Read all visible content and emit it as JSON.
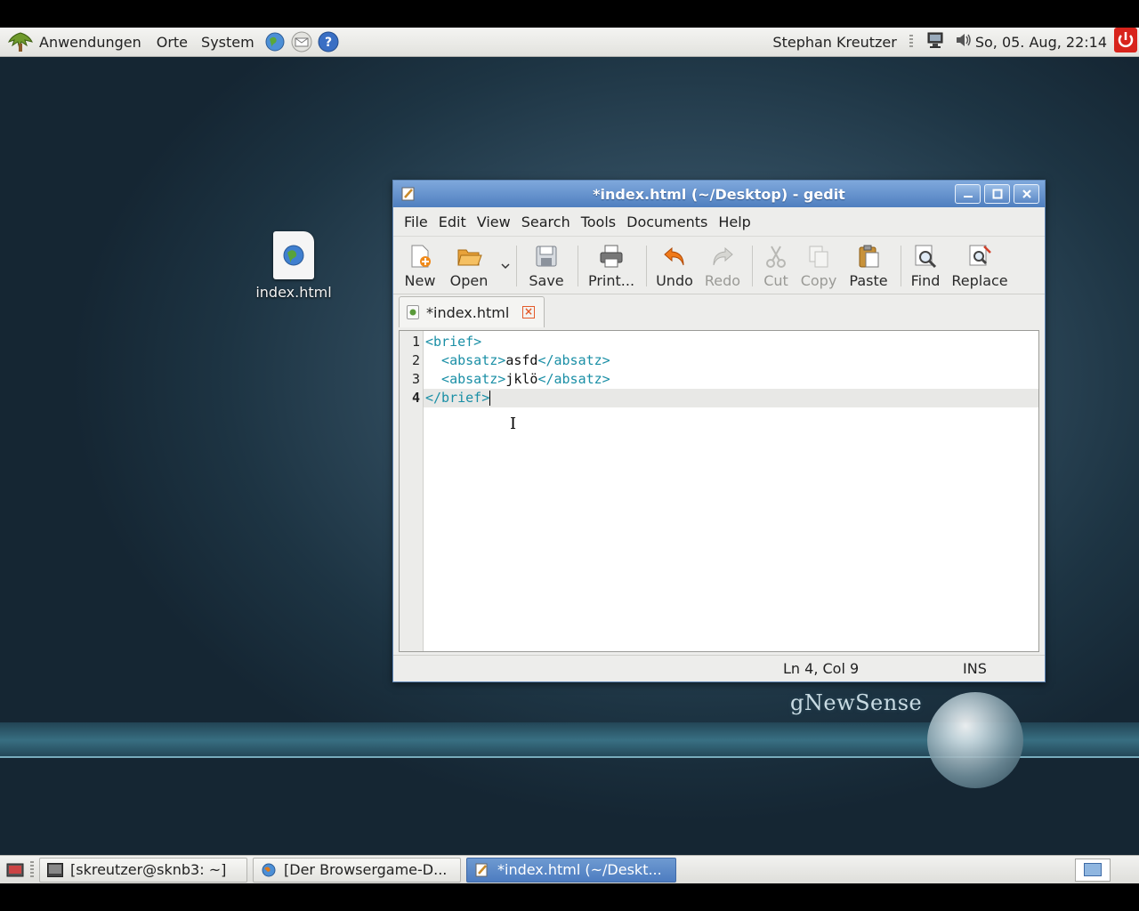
{
  "top_panel": {
    "menus": [
      "Anwendungen",
      "Orte",
      "System"
    ],
    "user": "Stephan Kreutzer",
    "clock": "So, 05. Aug, 22:14"
  },
  "desktop": {
    "icon_label": "index.html",
    "brand": "gNewSense"
  },
  "window": {
    "title": "*index.html (~/Desktop) - gedit",
    "menu": {
      "file": "File",
      "edit": "Edit",
      "view": "View",
      "search": "Search",
      "tools": "Tools",
      "documents": "Documents",
      "help": "Help"
    },
    "toolbar": {
      "new": "New",
      "open": "Open",
      "save": "Save",
      "print": "Print...",
      "undo": "Undo",
      "redo": "Redo",
      "cut": "Cut",
      "copy": "Copy",
      "paste": "Paste",
      "find": "Find",
      "replace": "Replace"
    },
    "tab_label": "*index.html",
    "line_numbers": [
      "1",
      "2",
      "3",
      "4"
    ],
    "code": {
      "l1_tag": "<brief>",
      "l2_open": "  <absatz>",
      "l2_text": "asfd",
      "l2_close": "</absatz>",
      "l3_open": "  <absatz>",
      "l3_text": "jklö",
      "l3_close": "</absatz>",
      "l4_tag": "</brief>"
    },
    "status": {
      "position": "Ln 4, Col 9",
      "mode": "INS"
    }
  },
  "taskbar": {
    "tasks": [
      "[skreutzer@sknb3: ~]",
      "[Der Browsergame-D...",
      "*index.html (~/Deskt..."
    ]
  }
}
